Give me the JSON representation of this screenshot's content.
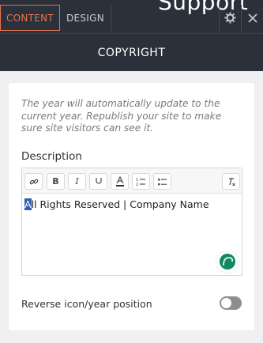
{
  "background_peek_text": "Support",
  "tabs": [
    {
      "label": "CONTENT",
      "active": true
    },
    {
      "label": "DESIGN",
      "active": false
    }
  ],
  "top_icons": [
    "gear-icon",
    "close-icon"
  ],
  "header": {
    "title": "COPYRIGHT"
  },
  "panel": {
    "help_text": "The year will automatically update to the current year. Republish your site to make sure site visitors can see it.",
    "description_label": "Description",
    "toolbar": [
      "link-icon",
      "bold-icon",
      "italic-icon",
      "underline-icon",
      "text-color-icon",
      "ordered-list-icon",
      "bullet-list-icon",
      "clear-format-icon"
    ],
    "editor": {
      "selected_text": "A",
      "rest_text": "ll Rights Reserved | Company Name"
    },
    "reverse_label": "Reverse icon/year position",
    "reverse_enabled": false
  },
  "colors": {
    "accent": "#e8734e",
    "topbar": "#2a313a",
    "assistant": "#0f8a5f"
  }
}
